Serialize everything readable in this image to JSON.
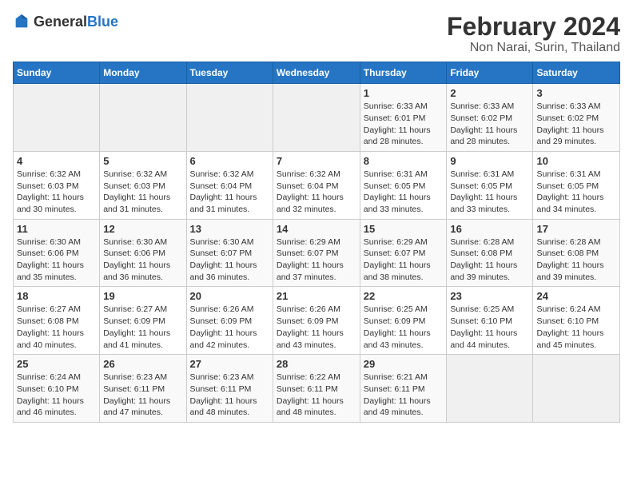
{
  "header": {
    "logo_general": "General",
    "logo_blue": "Blue",
    "title": "February 2024",
    "subtitle": "Non Narai, Surin, Thailand"
  },
  "weekdays": [
    "Sunday",
    "Monday",
    "Tuesday",
    "Wednesday",
    "Thursday",
    "Friday",
    "Saturday"
  ],
  "weeks": [
    [
      {
        "day": "",
        "empty": true
      },
      {
        "day": "",
        "empty": true
      },
      {
        "day": "",
        "empty": true
      },
      {
        "day": "",
        "empty": true
      },
      {
        "day": "1",
        "sunrise": "6:33 AM",
        "sunset": "6:01 PM",
        "daylight": "11 hours and 28 minutes."
      },
      {
        "day": "2",
        "sunrise": "6:33 AM",
        "sunset": "6:02 PM",
        "daylight": "11 hours and 28 minutes."
      },
      {
        "day": "3",
        "sunrise": "6:33 AM",
        "sunset": "6:02 PM",
        "daylight": "11 hours and 29 minutes."
      }
    ],
    [
      {
        "day": "4",
        "sunrise": "6:32 AM",
        "sunset": "6:03 PM",
        "daylight": "11 hours and 30 minutes."
      },
      {
        "day": "5",
        "sunrise": "6:32 AM",
        "sunset": "6:03 PM",
        "daylight": "11 hours and 31 minutes."
      },
      {
        "day": "6",
        "sunrise": "6:32 AM",
        "sunset": "6:04 PM",
        "daylight": "11 hours and 31 minutes."
      },
      {
        "day": "7",
        "sunrise": "6:32 AM",
        "sunset": "6:04 PM",
        "daylight": "11 hours and 32 minutes."
      },
      {
        "day": "8",
        "sunrise": "6:31 AM",
        "sunset": "6:05 PM",
        "daylight": "11 hours and 33 minutes."
      },
      {
        "day": "9",
        "sunrise": "6:31 AM",
        "sunset": "6:05 PM",
        "daylight": "11 hours and 33 minutes."
      },
      {
        "day": "10",
        "sunrise": "6:31 AM",
        "sunset": "6:05 PM",
        "daylight": "11 hours and 34 minutes."
      }
    ],
    [
      {
        "day": "11",
        "sunrise": "6:30 AM",
        "sunset": "6:06 PM",
        "daylight": "11 hours and 35 minutes."
      },
      {
        "day": "12",
        "sunrise": "6:30 AM",
        "sunset": "6:06 PM",
        "daylight": "11 hours and 36 minutes."
      },
      {
        "day": "13",
        "sunrise": "6:30 AM",
        "sunset": "6:07 PM",
        "daylight": "11 hours and 36 minutes."
      },
      {
        "day": "14",
        "sunrise": "6:29 AM",
        "sunset": "6:07 PM",
        "daylight": "11 hours and 37 minutes."
      },
      {
        "day": "15",
        "sunrise": "6:29 AM",
        "sunset": "6:07 PM",
        "daylight": "11 hours and 38 minutes."
      },
      {
        "day": "16",
        "sunrise": "6:28 AM",
        "sunset": "6:08 PM",
        "daylight": "11 hours and 39 minutes."
      },
      {
        "day": "17",
        "sunrise": "6:28 AM",
        "sunset": "6:08 PM",
        "daylight": "11 hours and 39 minutes."
      }
    ],
    [
      {
        "day": "18",
        "sunrise": "6:27 AM",
        "sunset": "6:08 PM",
        "daylight": "11 hours and 40 minutes."
      },
      {
        "day": "19",
        "sunrise": "6:27 AM",
        "sunset": "6:09 PM",
        "daylight": "11 hours and 41 minutes."
      },
      {
        "day": "20",
        "sunrise": "6:26 AM",
        "sunset": "6:09 PM",
        "daylight": "11 hours and 42 minutes."
      },
      {
        "day": "21",
        "sunrise": "6:26 AM",
        "sunset": "6:09 PM",
        "daylight": "11 hours and 43 minutes."
      },
      {
        "day": "22",
        "sunrise": "6:25 AM",
        "sunset": "6:09 PM",
        "daylight": "11 hours and 43 minutes."
      },
      {
        "day": "23",
        "sunrise": "6:25 AM",
        "sunset": "6:10 PM",
        "daylight": "11 hours and 44 minutes."
      },
      {
        "day": "24",
        "sunrise": "6:24 AM",
        "sunset": "6:10 PM",
        "daylight": "11 hours and 45 minutes."
      }
    ],
    [
      {
        "day": "25",
        "sunrise": "6:24 AM",
        "sunset": "6:10 PM",
        "daylight": "11 hours and 46 minutes."
      },
      {
        "day": "26",
        "sunrise": "6:23 AM",
        "sunset": "6:11 PM",
        "daylight": "11 hours and 47 minutes."
      },
      {
        "day": "27",
        "sunrise": "6:23 AM",
        "sunset": "6:11 PM",
        "daylight": "11 hours and 48 minutes."
      },
      {
        "day": "28",
        "sunrise": "6:22 AM",
        "sunset": "6:11 PM",
        "daylight": "11 hours and 48 minutes."
      },
      {
        "day": "29",
        "sunrise": "6:21 AM",
        "sunset": "6:11 PM",
        "daylight": "11 hours and 49 minutes."
      },
      {
        "day": "",
        "empty": true
      },
      {
        "day": "",
        "empty": true
      }
    ]
  ],
  "labels": {
    "sunrise_prefix": "Sunrise: ",
    "sunset_prefix": "Sunset: ",
    "daylight_prefix": "Daylight: "
  }
}
